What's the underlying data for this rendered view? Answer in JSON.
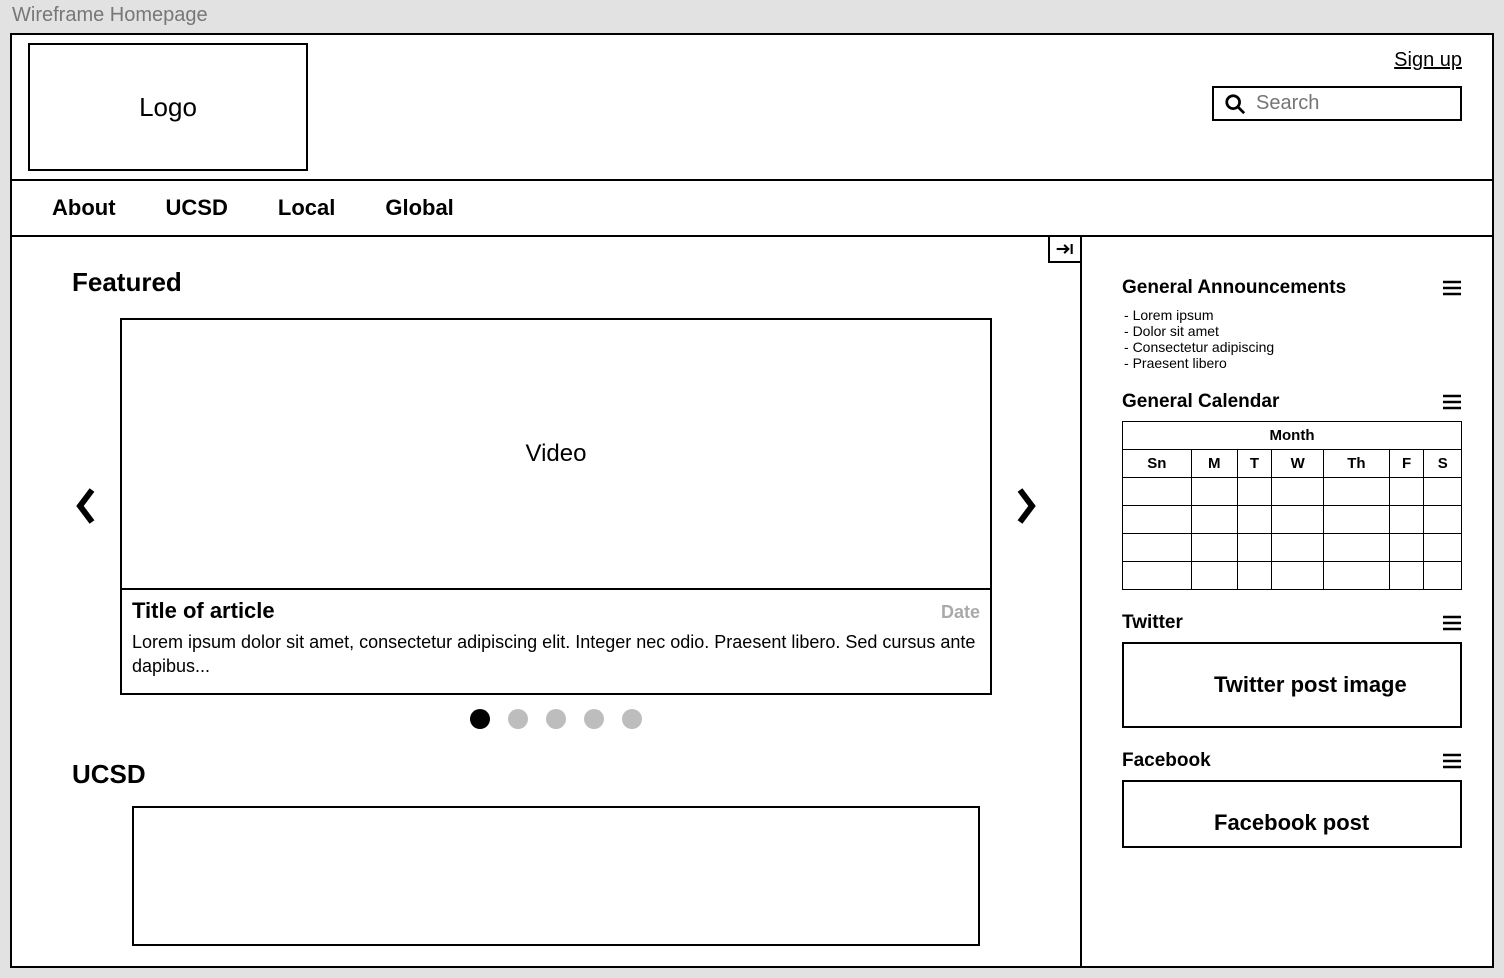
{
  "window_title": "Wireframe Homepage",
  "header": {
    "logo_text": "Logo",
    "signup": "Sign up",
    "search_placeholder": "Search"
  },
  "nav": {
    "about": "About",
    "ucsd": "UCSD",
    "local": "Local",
    "global": "Global"
  },
  "featured": {
    "heading": "Featured",
    "video_label": "Video",
    "article_title": "Title of article",
    "article_date": "Date",
    "article_excerpt": "Lorem ipsum dolor sit amet, consectetur adipiscing elit. Integer nec odio. Praesent libero. Sed cursus ante dapibus..."
  },
  "carousel": {
    "dot_count": 5,
    "active_index": 0
  },
  "ucsd_section": {
    "heading": "UCSD"
  },
  "sidebar": {
    "announcements": {
      "title": "General Announcements",
      "items": [
        "Lorem ipsum",
        "Dolor sit amet",
        "Consectetur adipiscing",
        "Praesent libero"
      ]
    },
    "calendar": {
      "title": "General Calendar",
      "month_label": "Month",
      "days": [
        "Sn",
        "M",
        "T",
        "W",
        "Th",
        "F",
        "S"
      ]
    },
    "twitter": {
      "title": "Twitter",
      "box_text": "Twitter post image"
    },
    "facebook": {
      "title": "Facebook",
      "box_text": "Facebook post"
    }
  }
}
